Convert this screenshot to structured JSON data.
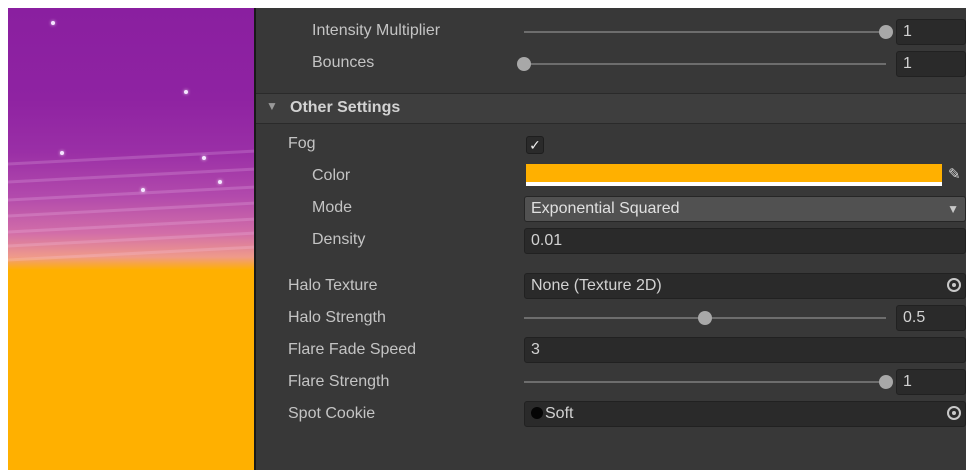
{
  "scene_preview": {
    "sky_top_color": "#8a1fa0",
    "ground_color": "#ffb000"
  },
  "lighting": {
    "intensity_multiplier": {
      "label": "Intensity Multiplier",
      "value": "1",
      "slider_fraction": 1.0
    },
    "bounces": {
      "label": "Bounces",
      "value": "1",
      "slider_fraction": 0.0
    }
  },
  "other_settings": {
    "title": "Other Settings",
    "expanded_icon": "triangle-down-icon",
    "fog": {
      "label": "Fog",
      "checked": true,
      "check_glyph": "✓"
    },
    "fog_color": {
      "label": "Color",
      "value": "#ffb000"
    },
    "fog_mode": {
      "label": "Mode",
      "value": "Exponential Squared",
      "caret": "▼"
    },
    "fog_density": {
      "label": "Density",
      "value": "0.01"
    },
    "halo_texture": {
      "label": "Halo Texture",
      "value": "None (Texture 2D)"
    },
    "halo_strength": {
      "label": "Halo Strength",
      "value": "0.5",
      "slider_fraction": 0.5
    },
    "flare_fade_speed": {
      "label": "Flare Fade Speed",
      "value": "3"
    },
    "flare_strength": {
      "label": "Flare Strength",
      "value": "1",
      "slider_fraction": 1.0
    },
    "spot_cookie": {
      "label": "Spot Cookie",
      "value": "Soft"
    }
  },
  "icons": {
    "eyedropper": "✎",
    "object_picker": "object-picker-icon"
  }
}
